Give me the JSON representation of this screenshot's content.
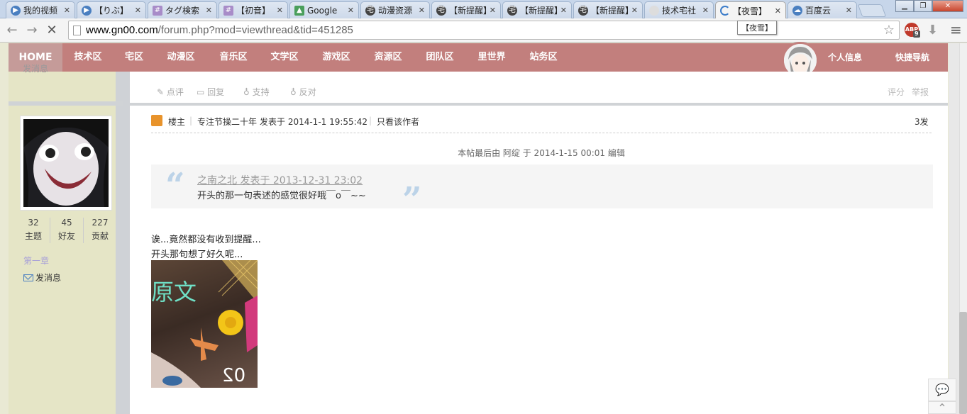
{
  "browser": {
    "tabs": [
      {
        "title": "我的视频",
        "icon": "play-icon"
      },
      {
        "title": "【りぶ】",
        "icon": "play-icon"
      },
      {
        "title": "タグ検索",
        "icon": "grid-icon"
      },
      {
        "title": "【初音】",
        "icon": "grid-icon"
      },
      {
        "title": "Google",
        "icon": "map-icon"
      },
      {
        "title": "动漫资源",
        "icon": "site-icon"
      },
      {
        "title": "【新提醒】",
        "icon": "site-icon"
      },
      {
        "title": "【新提醒】",
        "icon": "site-icon"
      },
      {
        "title": "【新提醒】",
        "icon": "site-icon"
      },
      {
        "title": "技术宅社",
        "icon": "site-icon"
      },
      {
        "title": "【夜雪】",
        "icon": "loading-icon"
      },
      {
        "title": "百度云",
        "icon": "cloud-icon"
      }
    ],
    "tooltip": "【夜雪】",
    "url_host": "www.gn00.com",
    "url_path": "/forum.php?mod=viewthread&tid=451285",
    "abp_label": "ABP",
    "abp_badge": "9"
  },
  "nav": {
    "home": "HOME",
    "items": [
      "技术区",
      "宅区",
      "动漫区",
      "音乐区",
      "文学区",
      "游戏区",
      "资源区",
      "团队区",
      "里世界",
      "站务区"
    ],
    "profile": "个人信息",
    "quicknav": "快捷导航"
  },
  "sidebar": {
    "top_msg": "发消息",
    "stats": [
      {
        "num": "32",
        "label": "主题"
      },
      {
        "num": "45",
        "label": "好友"
      },
      {
        "num": "227",
        "label": "贡献"
      }
    ],
    "chapter": "第一章",
    "send_msg": "发消息"
  },
  "actions": {
    "comment": "点评",
    "reply": "回复",
    "support": "支持",
    "oppose": "反对",
    "rate": "评分",
    "report": "举报"
  },
  "post": {
    "owner_label": "楼主",
    "author_title": "专注节操二十年",
    "posted": "发表于 2014-1-1 19:55:42",
    "only_author": "只看该作者",
    "floor": "3发",
    "edit_note": "本帖最后由 阿绽 于 2014-1-15 00:01 编辑",
    "quote_open": "“",
    "quote_close": "”",
    "quote_head": "之南之北 发表于 2013-12-31 23:02",
    "quote_body": "开头的那一句表述的感觉很好哦￣o￣~~",
    "line1": "诶...竟然都没有收到提醒...",
    "line2": "开头那句想了好久呢...",
    "image_text": "原文",
    "image_num": "02"
  },
  "colors": {
    "nav_bg": "#c27f7d",
    "sidebar_bg": "#e5e5c6",
    "quote_mark": "#bcd3e8"
  }
}
